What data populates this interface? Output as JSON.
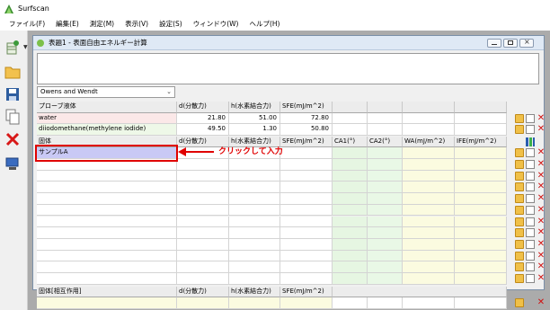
{
  "app": {
    "title": "Surfscan"
  },
  "menu": [
    "ファイル(F)",
    "編集(E)",
    "測定(M)",
    "表示(V)",
    "設定(S)",
    "ウィンドウ(W)",
    "ヘルプ(H)"
  ],
  "toolbar": {
    "icons": [
      "new-measurement-icon",
      "open-folder-icon",
      "save-icon",
      "copy-icon",
      "delete-icon",
      "device-icon"
    ],
    "dropdown_glyph": "▼"
  },
  "window": {
    "title": "表題1 - 表面自由エネルギー計算",
    "notes": "",
    "method": "Owens and Wendt",
    "method_chevron": "⌄"
  },
  "probe_table": {
    "headers": [
      "プローブ液体",
      "d(分散力)",
      "h(水素結合力)",
      "SFE(mJ/m^2)",
      "",
      "",
      "",
      ""
    ],
    "rows": [
      {
        "name": "water",
        "d": "21.80",
        "h": "51.00",
        "sfe": "72.80"
      },
      {
        "name": "diiodomethane(methylene iodide)",
        "d": "49.50",
        "h": "1.30",
        "sfe": "50.80"
      }
    ]
  },
  "solid_table": {
    "headers": [
      "固体",
      "d(分散力)",
      "h(水素結合力)",
      "SFE(mJ/m^2)",
      "CA1(°)",
      "CA2(°)",
      "WA(mJ/m^2)",
      "IFE(mJ/m^2)"
    ],
    "rows": [
      {
        "name": "サンプルA"
      },
      {
        "name": ""
      },
      {
        "name": ""
      },
      {
        "name": ""
      },
      {
        "name": ""
      },
      {
        "name": ""
      },
      {
        "name": ""
      },
      {
        "name": ""
      },
      {
        "name": ""
      },
      {
        "name": ""
      },
      {
        "name": ""
      },
      {
        "name": ""
      }
    ]
  },
  "interaction_table": {
    "headers": [
      "固体[相互作用]",
      "d(分散力)",
      "h(水素結合力)",
      "SFE(mJ/m^2)"
    ]
  },
  "callout": {
    "text": "クリックして入力",
    "color": "#e00000"
  },
  "colors": {
    "probe_row_bg": "#fbe8e8",
    "probe_row_bg2": "#eef8e8",
    "selected_row": "#c9c9f5",
    "ca1_bg": "#e6f6e2",
    "ca2_bg": "#e9f8e6",
    "wa_bg": "#fbfbe0",
    "ife_bg": "#fbfbe0",
    "interaction_bg": "#fbfbe0"
  }
}
